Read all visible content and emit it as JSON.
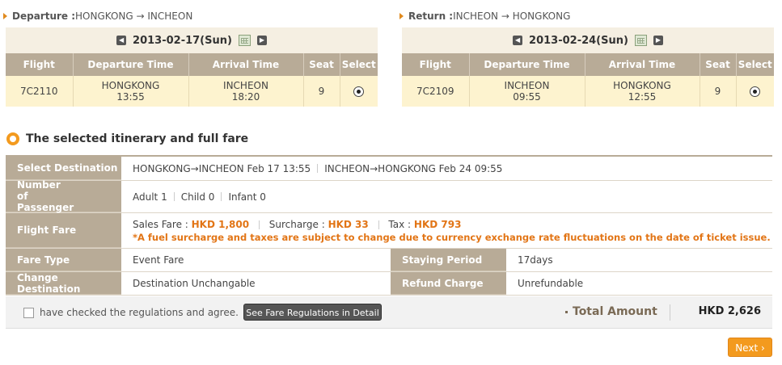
{
  "departure": {
    "label": "Departure :",
    "route": "HONGKONG → INCHEON",
    "date": "2013-02-17(Sun)",
    "columns": [
      "Flight",
      "Departure Time",
      "Arrival Time",
      "Seat",
      "Select"
    ],
    "flight": "7C2110",
    "dep_city": "HONGKONG",
    "dep_time": "13:55",
    "arr_city": "INCHEON",
    "arr_time": "18:20",
    "seat": "9"
  },
  "return": {
    "label": "Return :",
    "route": "INCHEON → HONGKONG",
    "date": "2013-02-24(Sun)",
    "columns": [
      "Flight",
      "Departure Time",
      "Arrival Time",
      "Seat",
      "Select"
    ],
    "flight": "7C2109",
    "dep_city": "INCHEON",
    "dep_time": "09:55",
    "arr_city": "HONGKONG",
    "arr_time": "12:55",
    "seat": "9"
  },
  "summary": {
    "title": "The selected itinerary and full fare",
    "labels": {
      "destination": "Select Destination",
      "passenger": "Number of Passenger",
      "fare": "Flight Fare",
      "fare_type": "Fare Type",
      "staying": "Staying Period",
      "change": "Change Destination",
      "refund": "Refund Charge"
    },
    "destination_out": "HONGKONG→INCHEON Feb 17 13:55",
    "destination_ret": "INCHEON→HONGKONG Feb 24 09:55",
    "adult": "Adult 1",
    "child": "Child 0",
    "infant": "Infant 0",
    "sales_label": "Sales Fare : ",
    "sales_value": "HKD 1,800",
    "surcharge_label": "Surcharge : ",
    "surcharge_value": "HKD 33",
    "tax_label": "Tax : ",
    "tax_value": "HKD 793",
    "notice": "*A fuel surcharge and taxes are subject to change due to currency exchange rate fluctuations on the date of ticket issue.",
    "fare_type": "Event Fare",
    "staying": "17days",
    "change": "Destination Unchangable",
    "refund": "Unrefundable"
  },
  "footer": {
    "agree": "have checked the regulations and agree.",
    "regulations_button": "See Fare Regulations in Detail",
    "total_label": "Total Amount",
    "total_value": "HKD 2,626",
    "next_button": "Next ›"
  },
  "colors": {
    "accent": "#f39a1e",
    "header": "#b8ab97",
    "row": "#fdf3cf"
  }
}
